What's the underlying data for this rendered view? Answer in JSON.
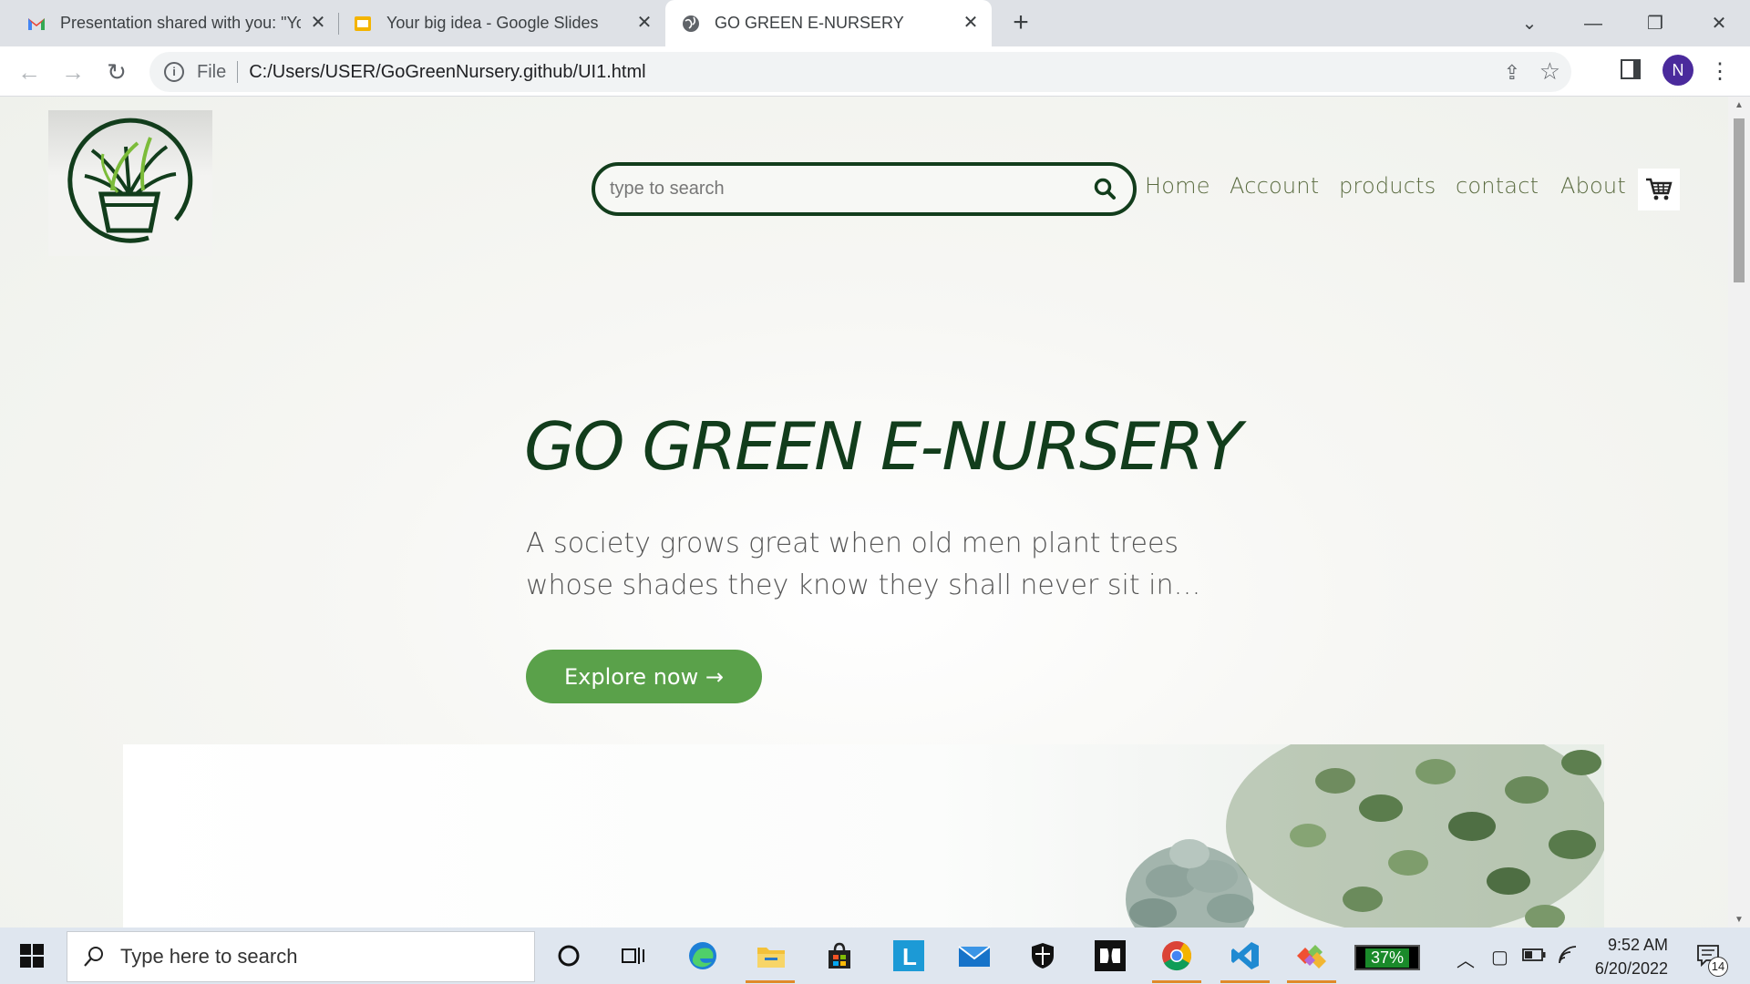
{
  "browser": {
    "tabs": [
      {
        "title": "Presentation shared with you: \"Yo",
        "favicon": "gmail-icon",
        "active": false
      },
      {
        "title": "Your big idea - Google Slides",
        "favicon": "google-slides-icon",
        "active": false
      },
      {
        "title": "GO GREEN E-NURSERY",
        "favicon": "globe-icon",
        "active": true
      }
    ],
    "new_tab": "+",
    "omnibox": {
      "scheme_label": "File",
      "url": "C:/Users/USER/GoGreenNursery.github/UI1.html"
    },
    "profile_initial": "N"
  },
  "site": {
    "search_placeholder": "type to search",
    "nav": [
      "Home",
      "Account",
      "products",
      "contact",
      "About"
    ],
    "hero_title": "GO GREEN E-NURSERY",
    "hero_quote": "A society grows great when old men plant trees whose shades they know they shall never sit in…",
    "cta_label": "Explore now →",
    "colors": {
      "brand_dark": "#123d1c",
      "nav_text": "#5a6b40",
      "cta_bg": "#5aa14a"
    }
  },
  "taskbar": {
    "search_placeholder": "Type here to search",
    "battery": "37%",
    "time": "9:52 AM",
    "date": "6/20/2022",
    "notification_count": "14",
    "pinned": [
      "cortana-icon",
      "task-view-icon",
      "edge-icon",
      "file-explorer-icon",
      "store-icon",
      "l-app-icon",
      "mail-icon",
      "security-icon",
      "dolby-icon",
      "chrome-icon",
      "vscode-icon",
      "git-icon"
    ]
  }
}
